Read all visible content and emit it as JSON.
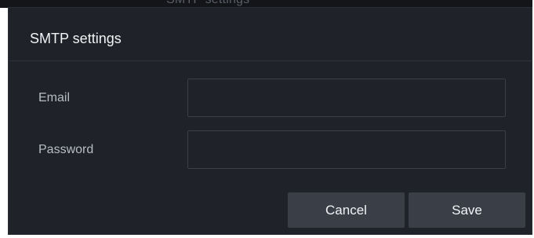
{
  "backdrop": {
    "title": "SMTP settings"
  },
  "dialog": {
    "title": "SMTP settings",
    "fields": {
      "email": {
        "label": "Email",
        "value": "",
        "placeholder": ""
      },
      "password": {
        "label": "Password",
        "value": "",
        "placeholder": ""
      }
    },
    "buttons": {
      "cancel_label": "Cancel",
      "save_label": "Save"
    }
  },
  "colors": {
    "dialog_background": "#1f2228",
    "button_background": "#3a3f47",
    "text_primary": "#f2f3f5",
    "text_secondary": "#b8bcc4",
    "input_border": "#3a3f47"
  }
}
